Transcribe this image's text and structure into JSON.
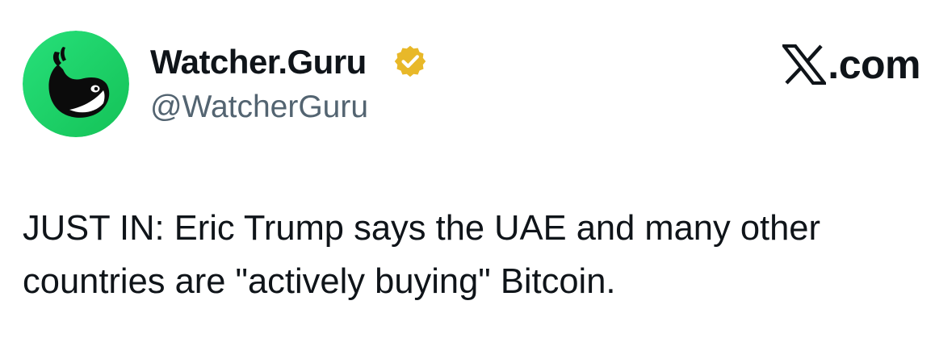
{
  "author": {
    "display_name": "Watcher.Guru",
    "handle": "@WatcherGuru",
    "verified": true,
    "verified_badge_icon": "gold-verified-badge-icon",
    "avatar_icon": "whale-icon",
    "avatar_color": "#1ed760"
  },
  "platform": {
    "logo_icon": "x-logo-icon",
    "domain": ".com"
  },
  "tweet": {
    "text": "JUST IN: Eric Trump says the UAE and many other\ncountries are \"actively buying\" Bitcoin."
  },
  "colors": {
    "text_primary": "#0f1419",
    "text_secondary": "#536471",
    "badge_gold": "#e8b829"
  }
}
